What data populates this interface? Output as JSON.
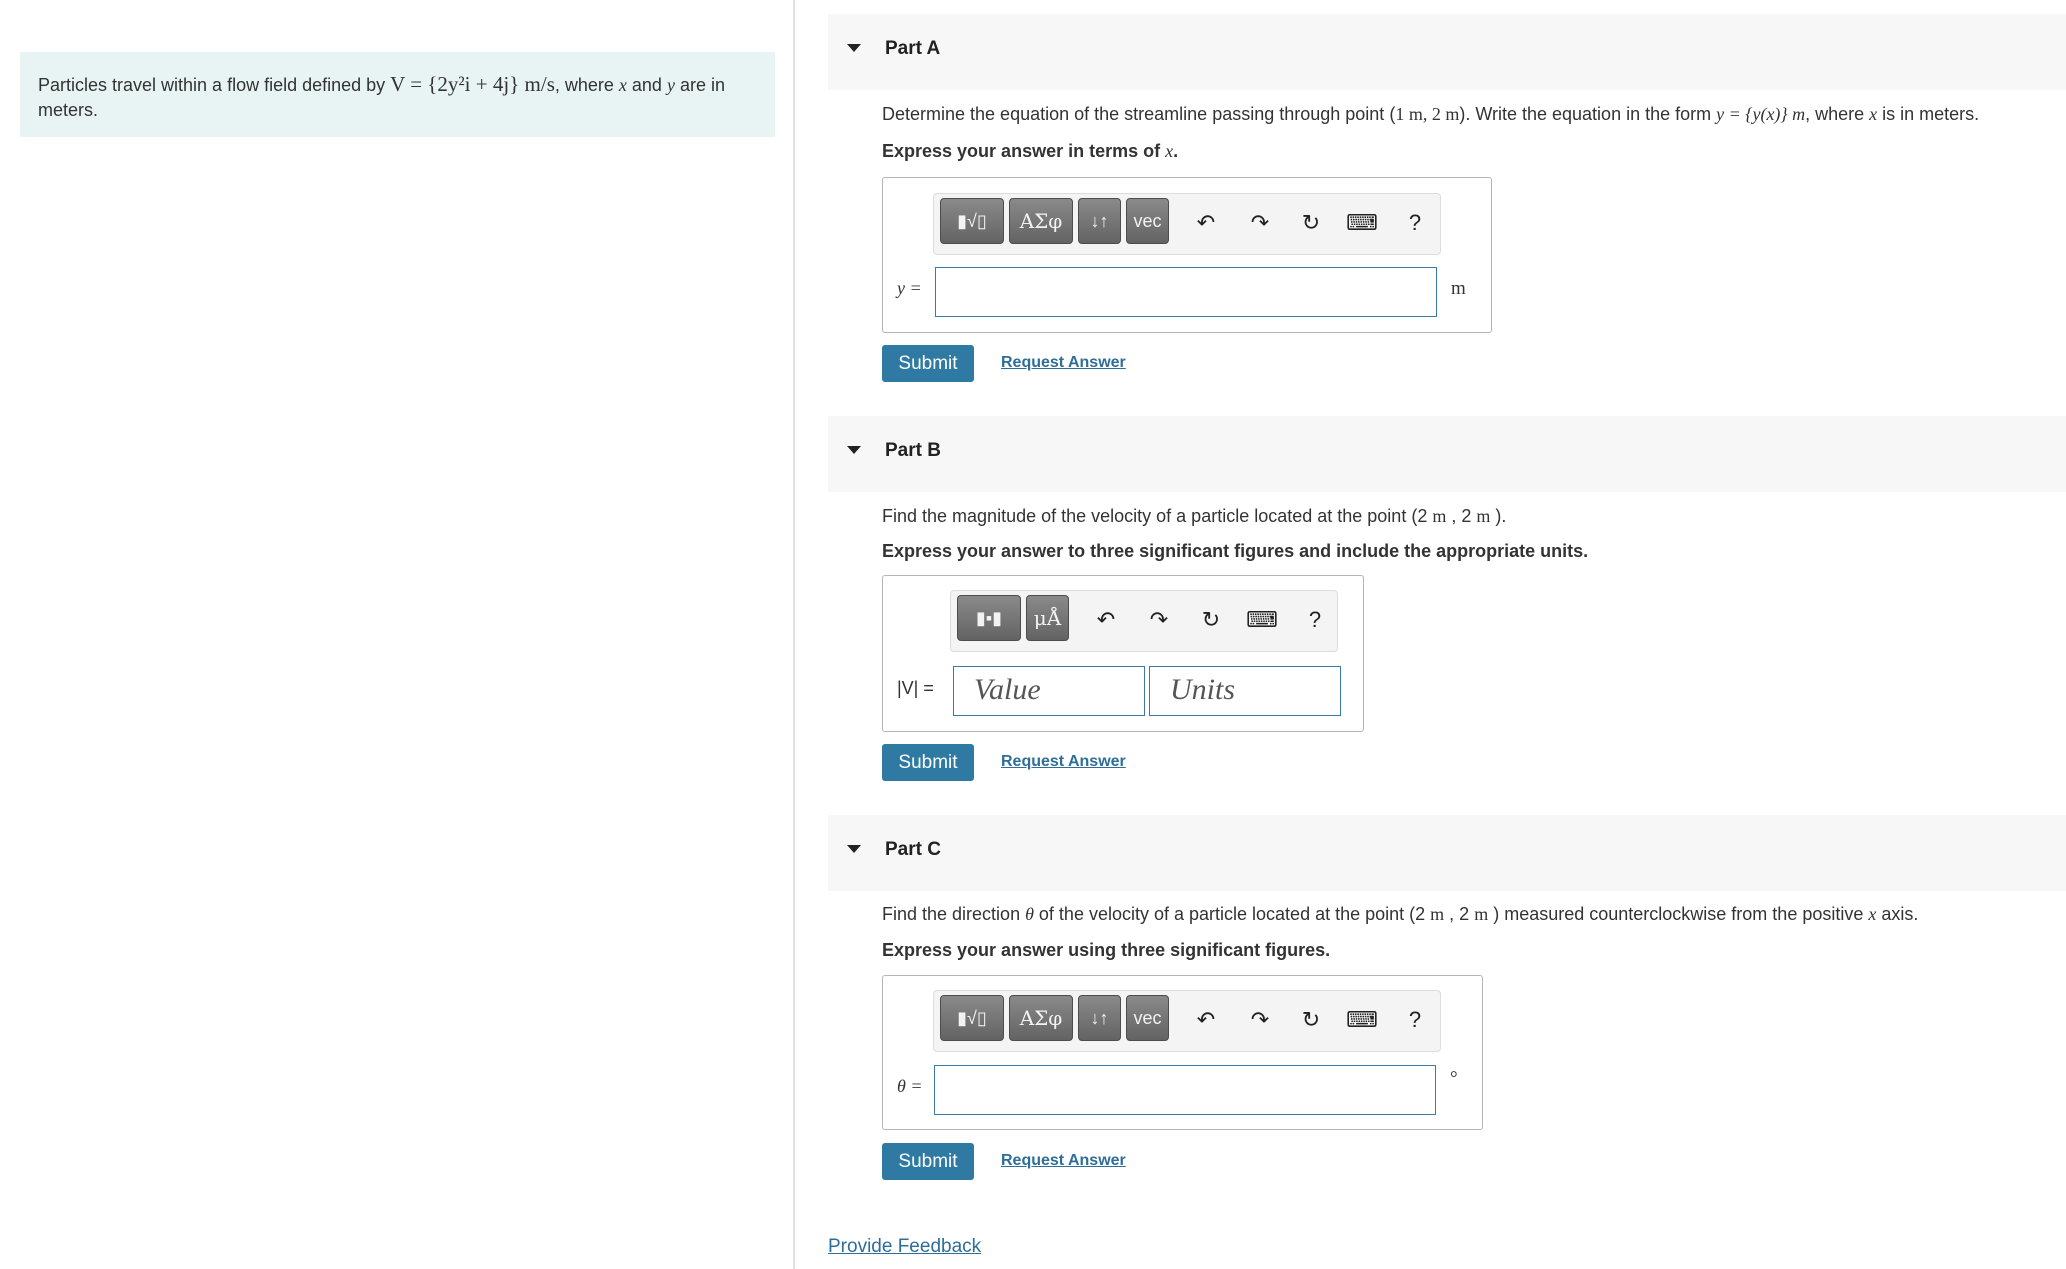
{
  "intro": {
    "text_before": "Particles travel within a flow field defined by ",
    "formula": "V = {2y²i + 4j} m/s",
    "text_mid": ", where ",
    "var_x": "x",
    "text_and": " and ",
    "var_y": "y",
    "text_after": " are in meters."
  },
  "parts": [
    {
      "title": "Part A",
      "question_pre": "Determine the equation of the streamline passing through point (",
      "point": "1 m, 2 m",
      "question_mid": "). Write the equation in the form ",
      "form": "y = {y(x)} m",
      "question_post": ", where ",
      "var": "x",
      "question_end": " is in meters.",
      "instruction_pre": "Express your answer in terms of ",
      "instruction_var": "x",
      "instruction_end": ".",
      "toolbar": [
        "templates",
        "ΑΣφ",
        "↓↑",
        "vec",
        "undo",
        "redo",
        "reset",
        "keyboard",
        "?"
      ],
      "answer_label": "y =",
      "answer_value": "",
      "unit": "m",
      "submit": "Submit",
      "request": "Request Answer"
    },
    {
      "title": "Part B",
      "question_pre": "Find the magnitude of the velocity of a particle located at the point (2  ",
      "unit1": "m",
      "comma": " , 2  ",
      "unit2": "m",
      "question_end": " ).",
      "instruction": "Express your answer to three significant figures and include the appropriate units.",
      "toolbar": [
        "templates",
        "μÅ",
        "undo",
        "redo",
        "reset",
        "keyboard",
        "?"
      ],
      "answer_label": "|V| =",
      "value_placeholder": "Value",
      "units_placeholder": "Units",
      "submit": "Submit",
      "request": "Request Answer"
    },
    {
      "title": "Part C",
      "question_pre": "Find the direction ",
      "theta": "θ",
      "question_mid": " of the velocity of a particle located at the point (2  ",
      "unit1": "m",
      "comma": " , 2  ",
      "unit2": "m",
      "question_post": " ) measured counterclockwise from the positive ",
      "var": "x",
      "question_end": " axis.",
      "instruction": "Express your answer using three significant figures.",
      "toolbar": [
        "templates",
        "ΑΣφ",
        "↓↑",
        "vec",
        "undo",
        "redo",
        "reset",
        "keyboard",
        "?"
      ],
      "answer_label": "θ =",
      "answer_value": "",
      "unit": "°",
      "submit": "Submit",
      "request": "Request Answer"
    }
  ],
  "feedback": "Provide Feedback",
  "colors": {
    "accent": "#2f7aa2",
    "link": "#2f6e99",
    "intro_bg": "#e8f4f4",
    "input_border": "#3b7aa8"
  }
}
